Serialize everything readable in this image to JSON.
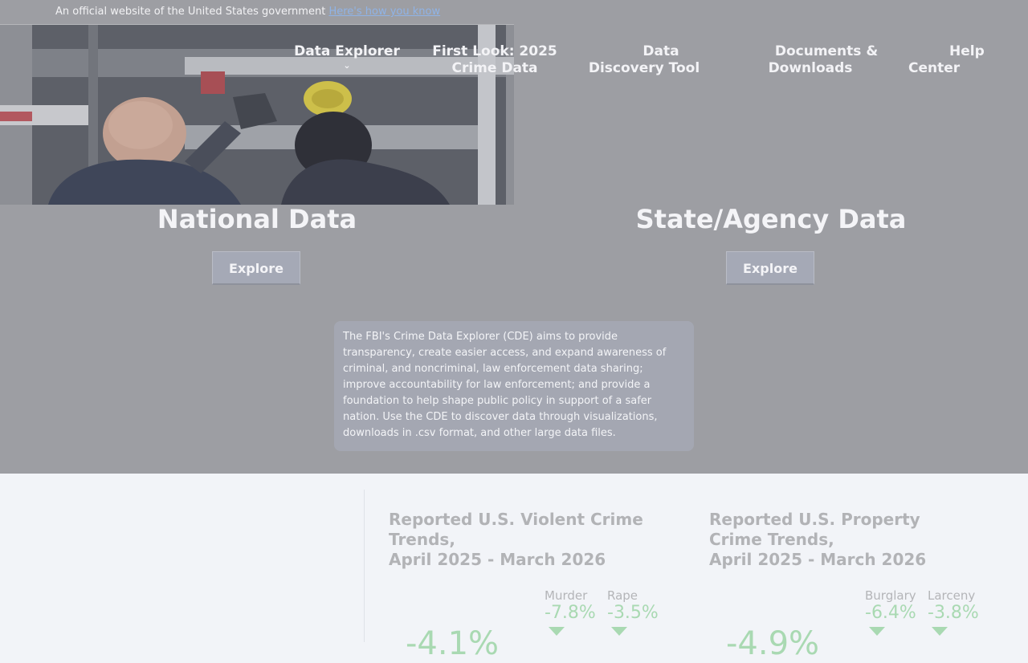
{
  "gov_banner": {
    "text": "An official website of the United States government",
    "link": "Here's how you know"
  },
  "nav": {
    "items": [
      {
        "label": "Data Explorer",
        "has_dropdown": true
      },
      {
        "line1": "First Look: 2025",
        "line2": "Crime Data"
      },
      {
        "line1": "Data",
        "line2": "Discovery Tool"
      },
      {
        "line1": "Documents &",
        "line2": "Downloads"
      },
      {
        "line1": "Help",
        "line2": "Center"
      }
    ],
    "dropdown_icon": "chevron-down-icon"
  },
  "sections": {
    "national": {
      "title": "National Data",
      "button": "Explore"
    },
    "state": {
      "title": "State/Agency Data",
      "button": "Explore"
    }
  },
  "description": "The FBI's Crime Data Explorer (CDE) aims to provide transparency, create easier access, and expand awareness of criminal, and noncriminal, law enforcement data sharing; improve accountability for law enforcement; and provide a foundation to help shape public policy in support of a safer nation. Use the CDE to discover data through visualizations, downloads in .csv format, and other large data files.",
  "trends": {
    "violent": {
      "title_line1": "Reported U.S. Violent Crime",
      "title_line2": "Trends,",
      "title_line3": "April 2025 - March 2026",
      "overall": "-4.1%",
      "stats": [
        {
          "label": "Murder",
          "value": "-7.8%",
          "direction": "down"
        },
        {
          "label": "Rape",
          "value": "-3.5%",
          "direction": "down"
        }
      ]
    },
    "property": {
      "title_line1": "Reported U.S. Property",
      "title_line2": "Crime Trends,",
      "title_line3": "April 2025 - March 2026",
      "overall": "-4.9%",
      "stats": [
        {
          "label": "Burglary",
          "value": "-6.4%",
          "direction": "down"
        },
        {
          "label": "Larceny",
          "value": "-3.8%",
          "direction": "down"
        }
      ]
    }
  },
  "colors": {
    "overlay": "#9d9ea3",
    "decrease": "#a9d9b2",
    "link": "#8fb3e6",
    "page_bg": "#f2f4f8"
  }
}
